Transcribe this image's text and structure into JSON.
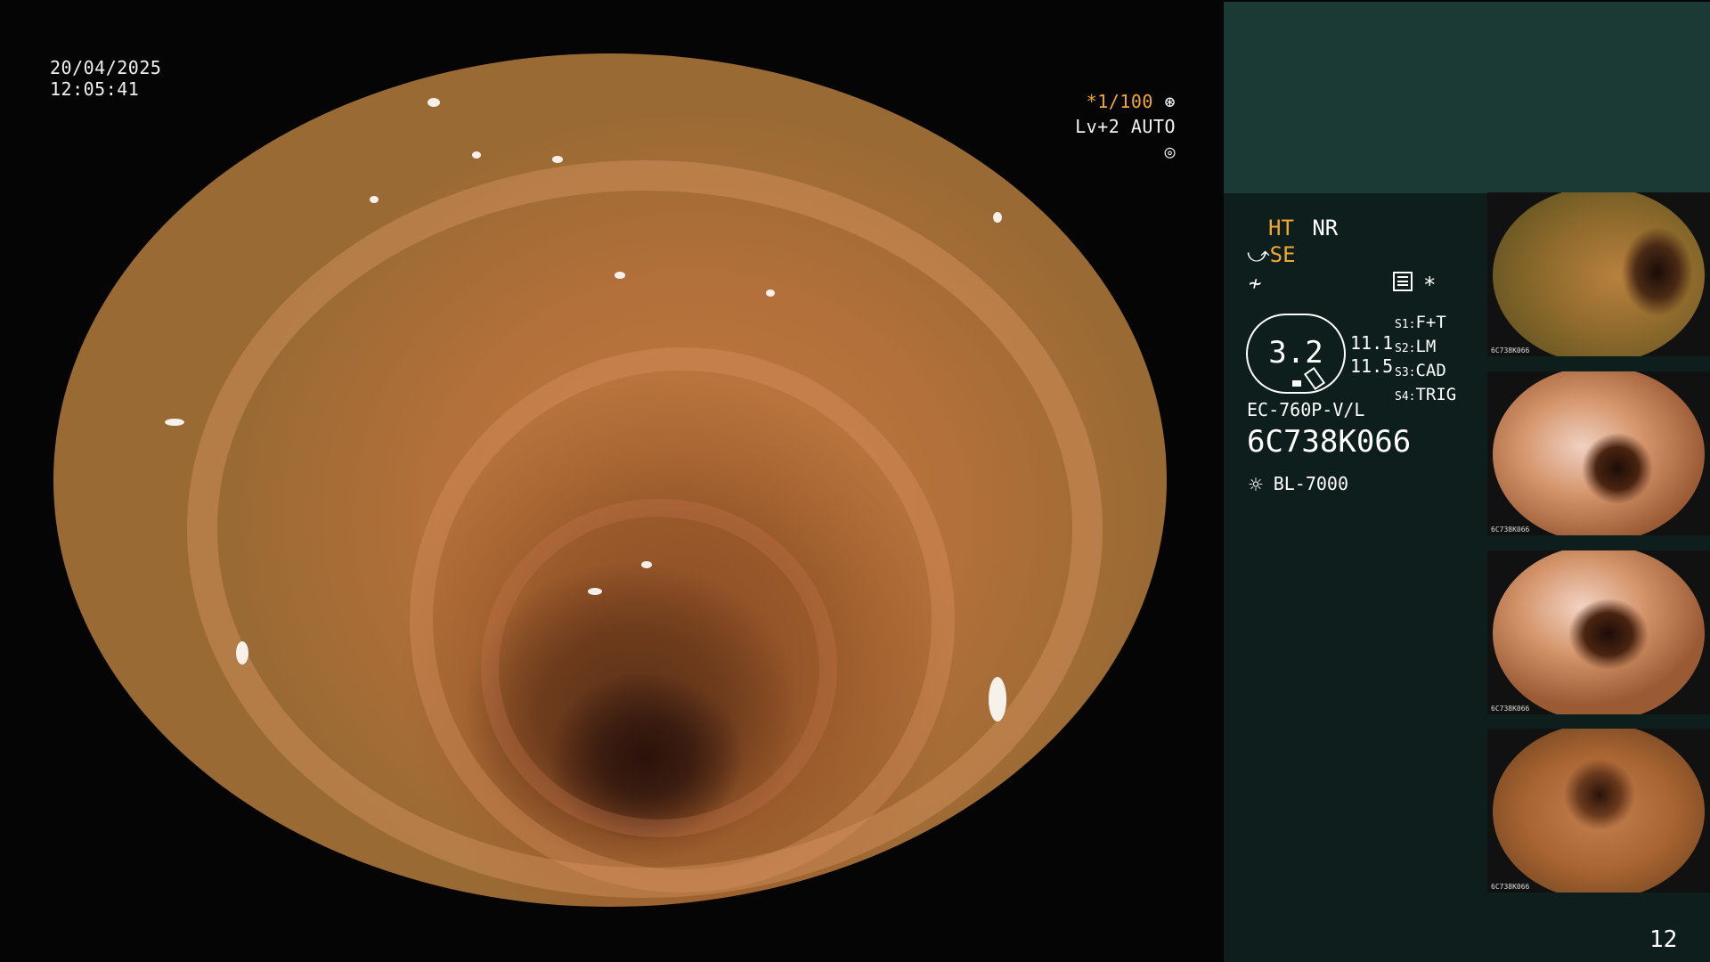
{
  "overlay": {
    "date": "20/04/2025",
    "time": "12:05:41",
    "shutter": "*1/100",
    "level": "Lv+2 AUTO"
  },
  "panel": {
    "ht": "HT",
    "nr": "NR",
    "se": "SE",
    "zoom": "3.2",
    "val1": "11.1",
    "val2": "11.5",
    "s_labels": [
      "S1:",
      "S2:",
      "S3:",
      "S4:"
    ],
    "s_values": [
      "F+T",
      "LM",
      "CAD",
      "TRIG"
    ],
    "scope_model": "EC-760P-V/L",
    "serial": "6C738K066",
    "light_source": "BL-7000",
    "asterisk": "*",
    "page_number": "12"
  },
  "thumbnails": [
    {
      "serial": "6C738K066"
    },
    {
      "serial": "6C738K066"
    },
    {
      "serial": "6C738K066"
    },
    {
      "serial": "6C738K066"
    }
  ],
  "colors": {
    "accent": "#f0a830",
    "panel_top": "#1b3a36",
    "panel_main": "#0d1e1d"
  }
}
